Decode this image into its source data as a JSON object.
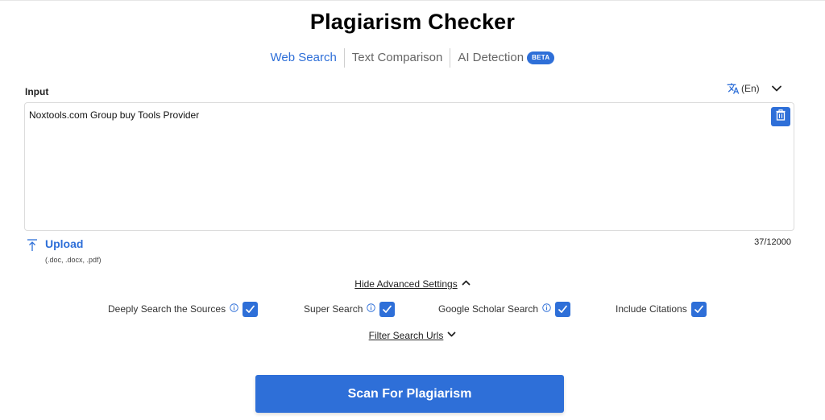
{
  "page": {
    "title": "Plagiarism Checker"
  },
  "tabs": [
    {
      "label": "Web Search",
      "active": true
    },
    {
      "label": "Text Comparison",
      "active": false
    },
    {
      "label": "AI Detection",
      "active": false,
      "badge": "BETA"
    }
  ],
  "input": {
    "label": "Input",
    "language": "(En)",
    "text": "Noxtools.com Group buy Tools Provider",
    "char_count": "37/12000"
  },
  "upload": {
    "label": "Upload",
    "hint": "(.doc, .docx, .pdf)"
  },
  "advanced": {
    "toggle_label": "Hide Advanced Settings",
    "options": [
      {
        "label": "Deeply Search the Sources",
        "checked": true,
        "has_info": true
      },
      {
        "label": "Super Search",
        "checked": true,
        "has_info": true
      },
      {
        "label": "Google Scholar Search",
        "checked": true,
        "has_info": true
      },
      {
        "label": "Include Citations",
        "checked": true,
        "has_info": false
      }
    ],
    "filter_label": "Filter Search Urls"
  },
  "actions": {
    "scan_label": "Scan For Plagiarism"
  },
  "colors": {
    "accent": "#2e6fd8",
    "text": "#222222",
    "muted": "#666666",
    "border": "#dcdcdc"
  },
  "icons": [
    "translate-icon",
    "chevron-down-icon",
    "trash-icon",
    "upload-icon",
    "info-icon",
    "checkmark-icon",
    "chevron-up-icon"
  ]
}
